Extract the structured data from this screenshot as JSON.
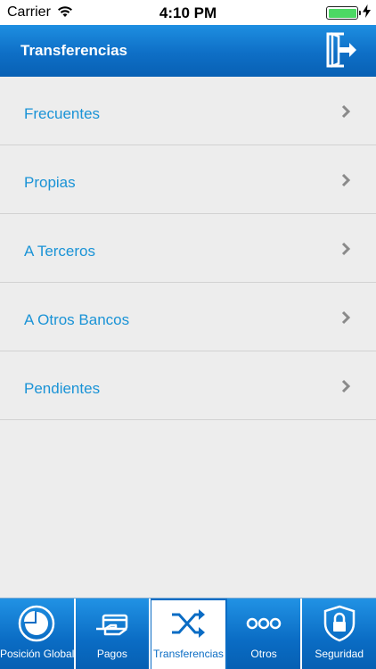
{
  "status_bar": {
    "carrier": "Carrier",
    "time": "4:10 PM"
  },
  "header": {
    "title": "Transferencias",
    "action_icon": "logout-icon"
  },
  "menu": {
    "items": [
      {
        "label": "Frecuentes"
      },
      {
        "label": "Propias"
      },
      {
        "label": "A Terceros"
      },
      {
        "label": "A Otros Bancos"
      },
      {
        "label": "Pendientes"
      }
    ]
  },
  "tabbar": {
    "active": "Transferencias",
    "tabs": [
      {
        "label": "Posición Global",
        "icon": "pie-chart-icon"
      },
      {
        "label": "Pagos",
        "icon": "payment-hand-icon"
      },
      {
        "label": "Transferencias",
        "icon": "transfer-arrows-icon"
      },
      {
        "label": "Otros",
        "icon": "more-dots-icon"
      },
      {
        "label": "Seguridad",
        "icon": "security-lock-icon"
      }
    ]
  },
  "colors": {
    "brand_blue": "#0a6cc4",
    "link_blue": "#1a93d6",
    "background": "#ededed"
  }
}
